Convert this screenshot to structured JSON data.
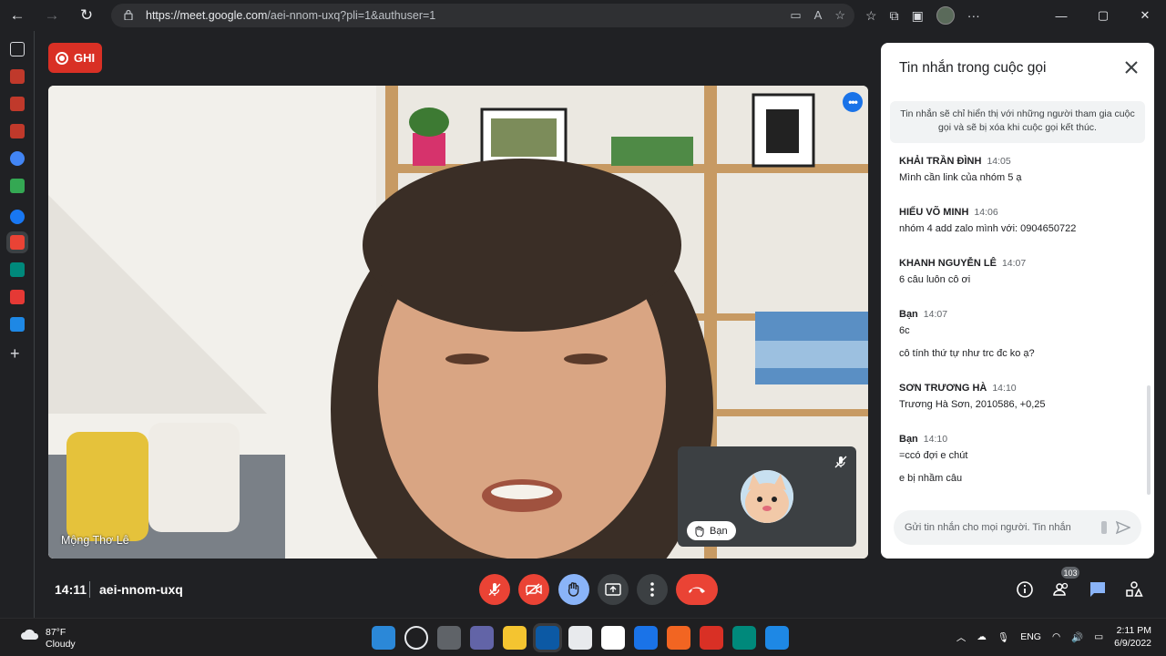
{
  "browser": {
    "url_host": "https://meet.google.com",
    "url_path": "/aei-nnom-uxq?pli=1&authuser=1"
  },
  "meet": {
    "recording_label": "GHI",
    "speaker_name": "Mộng Thơ Lê",
    "self_label": "Bạn",
    "time": "14:11",
    "meeting_code": "aei-nnom-uxq",
    "participant_count": "103"
  },
  "chat": {
    "title": "Tin nhắn trong cuộc gọi",
    "notice": "Tin nhắn sẽ chỉ hiển thị với những người tham gia cuộc gọi và sẽ bị xóa khi cuộc gọi kết thúc.",
    "input_placeholder": "Gửi tin nhắn cho mọi người. Tin nhắn",
    "messages": [
      {
        "sender": "KHẢI TRẦN ĐÌNH",
        "time": "14:05",
        "lines": [
          "Mình cần link của nhóm 5 ạ"
        ]
      },
      {
        "sender": "HIẾU VÕ MINH",
        "time": "14:06",
        "lines": [
          "nhóm 4 add zalo mình với: 0904650722"
        ]
      },
      {
        "sender": "KHANH NGUYỄN LÊ",
        "time": "14:07",
        "lines": [
          "6 câu luôn cô ơi"
        ]
      },
      {
        "sender": "Bạn",
        "time": "14:07",
        "lines": [
          "6c",
          "cô tính thứ tự như trc đc ko ạ?"
        ]
      },
      {
        "sender": "SƠN TRƯƠNG HÀ",
        "time": "14:10",
        "lines": [
          "Trương Hà Sơn, 2010586, +0,25"
        ]
      },
      {
        "sender": "Bạn",
        "time": "14:10",
        "lines": [
          "=ccó đợi e chút",
          "e bị nhầm câu"
        ]
      }
    ]
  },
  "taskbar": {
    "temperature": "87°F",
    "condition": "Cloudy",
    "language": "ENG",
    "clock_time": "2:11 PM",
    "clock_date": "6/9/2022"
  },
  "colors": {
    "meet_red": "#ea4335",
    "raise_hand_blue": "#8ab4f8",
    "record_red": "#d93025",
    "more_blue": "#1a73e8"
  }
}
